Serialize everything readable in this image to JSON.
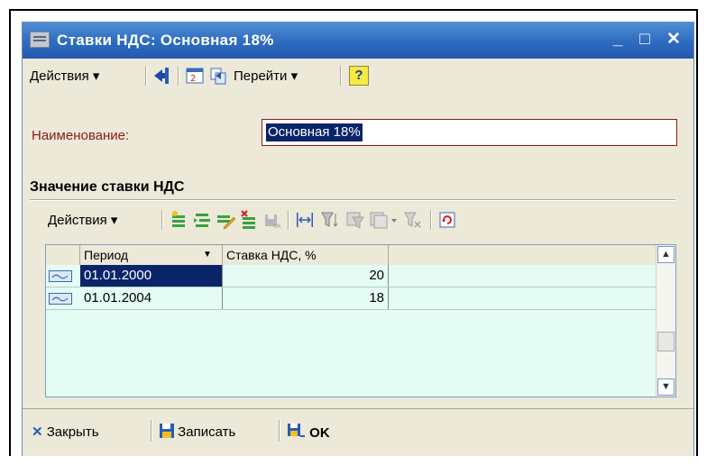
{
  "window": {
    "title": "Ставки НДС: Основная 18%",
    "minimize": "_",
    "maximize": "□",
    "close": "✕"
  },
  "toolbar": {
    "actions_label": "Действия",
    "goto_label": "Перейти",
    "help_label": "?"
  },
  "form": {
    "name_label": "Наименование:",
    "name_value": "Основная 18%"
  },
  "section": {
    "title": "Значение ставки НДС",
    "actions_label": "Действия"
  },
  "table": {
    "columns": [
      "Период",
      "Ставка НДС, %"
    ],
    "rows": [
      {
        "period": "01.01.2000",
        "rate": "20"
      },
      {
        "period": "01.01.2004",
        "rate": "18"
      }
    ]
  },
  "footer": {
    "close_label": "Закрыть",
    "save_label": "Записать",
    "ok_label": "OK"
  },
  "colors": {
    "titlebar": "#2d6bc0",
    "row_bg": "#e4fcf4",
    "selection": "#0a246a",
    "label_red": "#8b1a1a"
  }
}
